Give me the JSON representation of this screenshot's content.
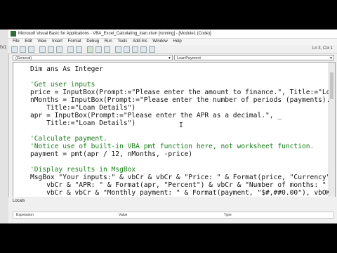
{
  "window": {
    "title": "Microsoft Visual Basic for Applications - VBA_Excel_Calculating_loan.xlsm [running] - [Module1 (Code)]",
    "app_strip_label": "fx1"
  },
  "menu": [
    "File",
    "Edit",
    "View",
    "Insert",
    "Format",
    "Debug",
    "Run",
    "Tools",
    "Add-Ins",
    "Window",
    "Help"
  ],
  "toolbar": {
    "position": "Ln 3, Col 1"
  },
  "procedure": {
    "object_combo": "(General)",
    "proc_combo": "LoanPayment"
  },
  "code_lines": [
    "Dim ans As Integer",
    "",
    "'Get user inputs",
    "price = InputBox(Prompt:=\"Please enter the amount to finance.\", Title:=\"Loan Detail",
    "nMonths = InputBox(Prompt:=\"Please enter the number of periods (payments).\", _",
    "    Title:=\"Loan Details\")",
    "apr = InputBox(Prompt:=\"Please enter the APR as a decimal.\", _",
    "    Title:=\"Loan Details\")",
    "",
    "'Calculate payment.",
    "'Notice use of built-in VBA pmt function here, not worksheet function.",
    "payment = pmt(apr / 12, nMonths, -price)",
    "",
    "'Display results in MsgBox",
    "MsgBox \"Your inputs:\" & vbCr & vbCr & \"Price: \" & Format(price, \"Currency\") &",
    "    vbCr & \"APR: \" & Format(apr, \"Percent\") & vbCr & \"Number of months: \" & nMonths",
    "    vbCr & vbCr & \"Monthly payment: \" & Format(payment, \"$#,##0.00\"), vbOKOnly, \"Mo"
  ],
  "cursor_glyph": "I",
  "locals": {
    "title": "Locals",
    "columns": [
      "Expression",
      "Value",
      "Type"
    ]
  }
}
